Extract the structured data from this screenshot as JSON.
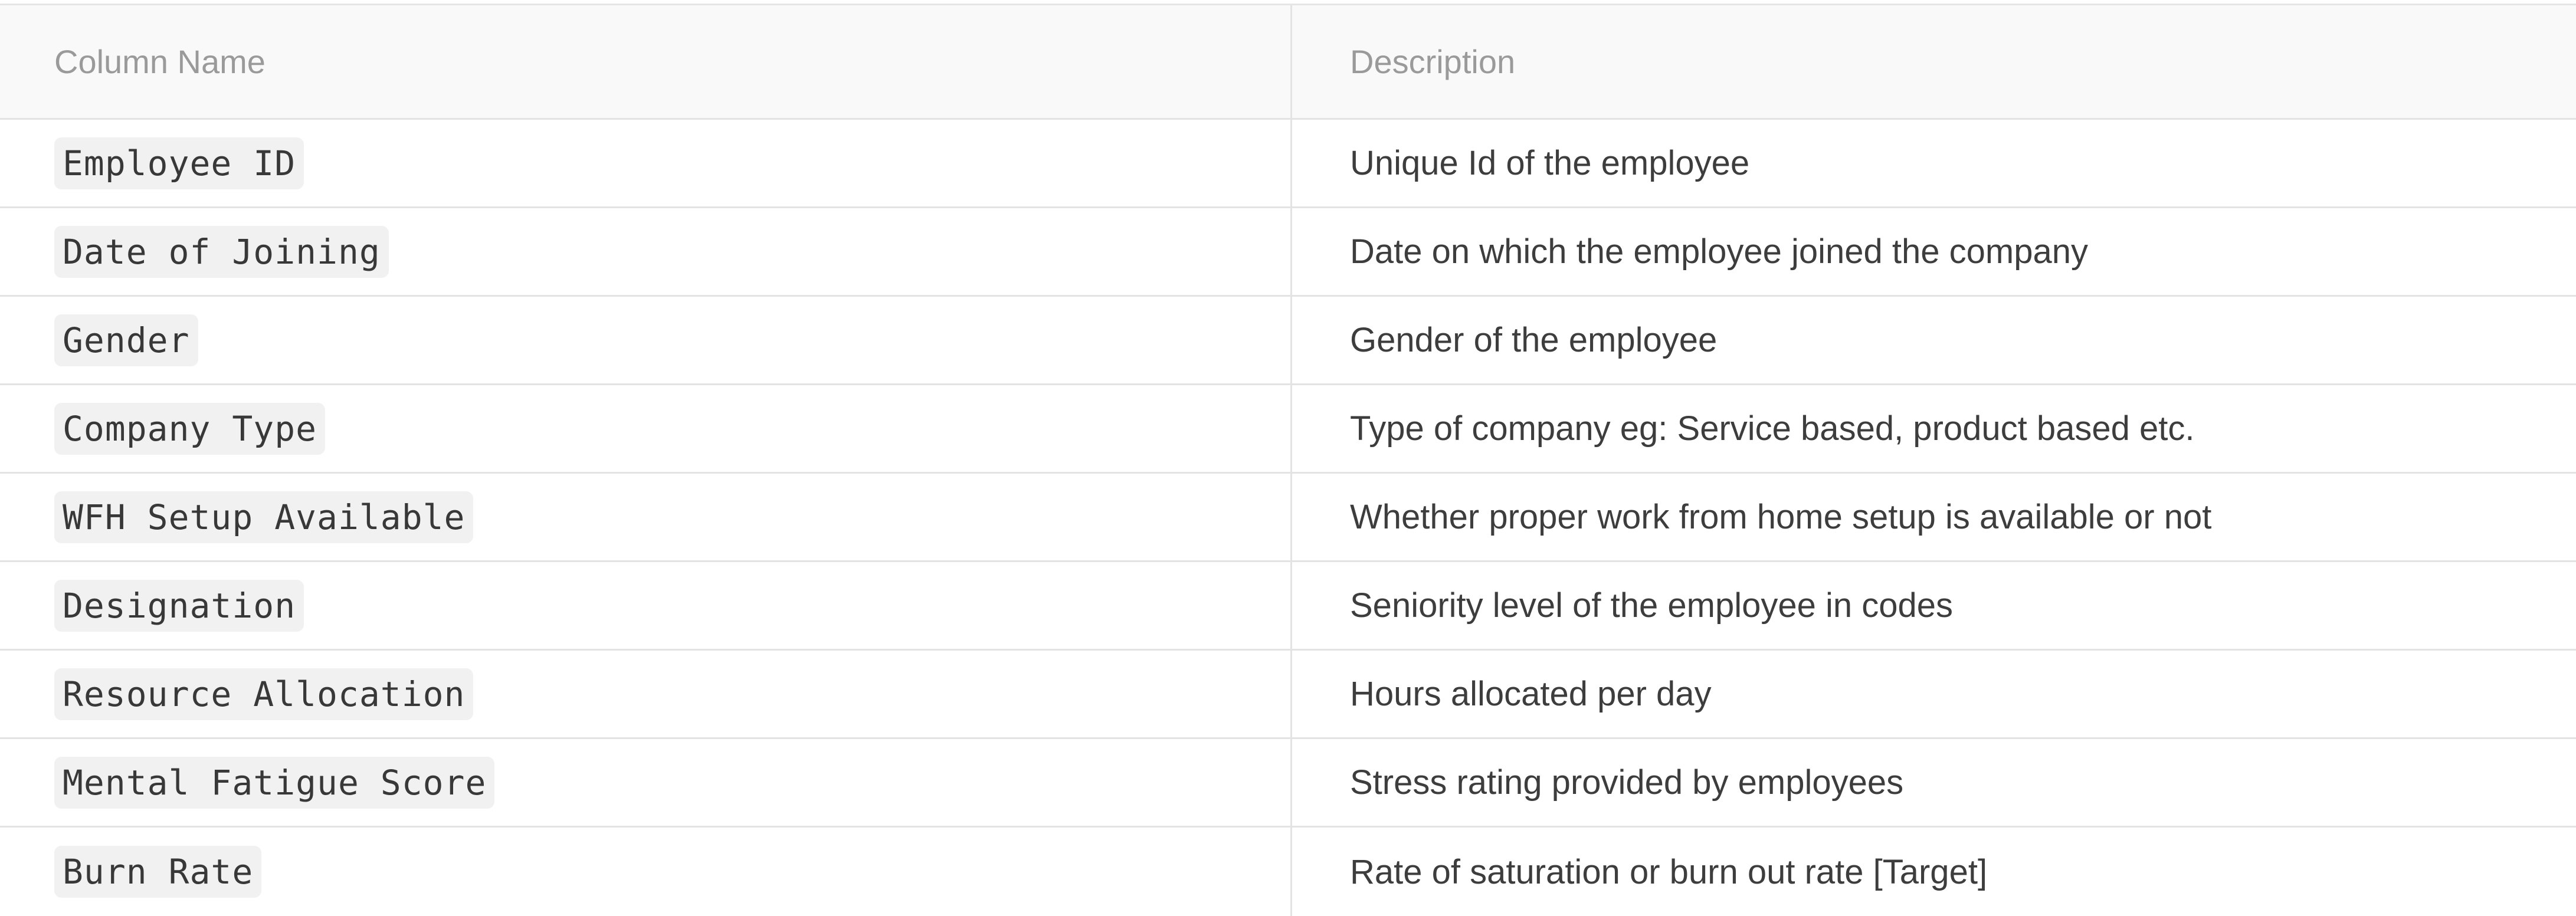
{
  "table": {
    "headers": [
      "Column Name",
      "Description"
    ],
    "rows": [
      {
        "column": "Employee ID",
        "description": "Unique Id of the employee"
      },
      {
        "column": "Date of Joining",
        "description": "Date on which the employee joined the company"
      },
      {
        "column": "Gender",
        "description": "Gender of the employee"
      },
      {
        "column": "Company Type",
        "description": "Type of company eg: Service based, product based etc."
      },
      {
        "column": "WFH Setup Available",
        "description": "Whether proper work from home setup is available or not"
      },
      {
        "column": "Designation",
        "description": "Seniority level of the employee in codes"
      },
      {
        "column": "Resource Allocation",
        "description": "Hours allocated per day"
      },
      {
        "column": "Mental Fatigue Score",
        "description": "Stress rating provided by employees"
      },
      {
        "column": "Burn Rate",
        "description": "Rate of saturation or burn out rate [Target]"
      }
    ]
  }
}
